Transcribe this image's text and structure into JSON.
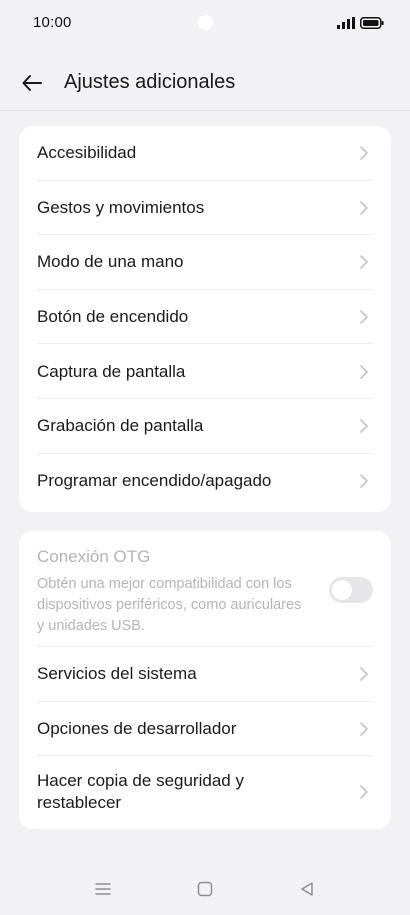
{
  "status_bar": {
    "time": "10:00",
    "icons": [
      "signal-icon",
      "battery-icon"
    ]
  },
  "header": {
    "title": "Ajustes adicionales",
    "back_icon": "back-arrow-icon"
  },
  "group1": {
    "items": [
      {
        "label": "Accesibilidad"
      },
      {
        "label": "Gestos y movimientos"
      },
      {
        "label": "Modo de una mano"
      },
      {
        "label": "Botón de encendido"
      },
      {
        "label": "Captura de pantalla"
      },
      {
        "label": "Grabación de pantalla"
      },
      {
        "label": "Programar encendido/apagado"
      }
    ]
  },
  "group2": {
    "otg": {
      "title": "Conexión OTG",
      "description": "Obtén una mejor compatibilidad con los dispositivos periféricos, como auriculares y unidades USB.",
      "enabled": false,
      "disabled_state": true
    },
    "items": [
      {
        "label": "Servicios del sistema"
      },
      {
        "label": "Opciones de desarrollador"
      },
      {
        "label": "Hacer copia de seguridad y restablecer"
      }
    ]
  },
  "nav_bar": {
    "icons": [
      "menu-icon",
      "home-icon",
      "back-triangle-icon"
    ]
  },
  "colors": {
    "background": "#f2f2f4",
    "card": "#ffffff",
    "text": "#1a1a1a",
    "disabled_text": "#b5b5b8",
    "chevron": "#c4c4c7"
  }
}
